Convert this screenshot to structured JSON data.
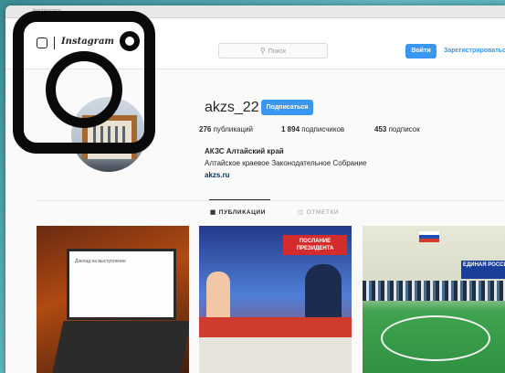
{
  "browser": {
    "tab_text": "Instagram"
  },
  "header": {
    "logo_word": "Instagram",
    "search_placeholder": "Поиск",
    "login_label": "Войти",
    "register_label": "Зарегистрироваться"
  },
  "profile": {
    "username": "akzs_22",
    "follow_label": "Подписаться",
    "stats": [
      {
        "count": "276",
        "label": "публикаций"
      },
      {
        "count": "1 894",
        "label": "подписчиков"
      },
      {
        "count": "453",
        "label": "подписок"
      }
    ],
    "full_name": "АКЗС Алтайский край",
    "bio": "Алтайское краевое Законодательное Собрание",
    "website": "akzs.ru"
  },
  "tabs": [
    {
      "label": "ПУБЛИКАЦИИ",
      "icon": "grid-icon",
      "active": true
    },
    {
      "label": "ОТМЕТКИ",
      "icon": "tag-icon",
      "active": false
    }
  ],
  "posts": {
    "post1_screen_text": "Доклад на выступление",
    "post2_banner": "ПОСЛАНИЕ ПРЕЗИДЕНТА",
    "post3_sign": "ЕДИНАЯ РОССИЯ"
  },
  "colors": {
    "accent": "#3897f0",
    "background": "#fafafa",
    "outer_gradient": "#4aa3ab",
    "logo_overlay": "#0a0a0a"
  }
}
